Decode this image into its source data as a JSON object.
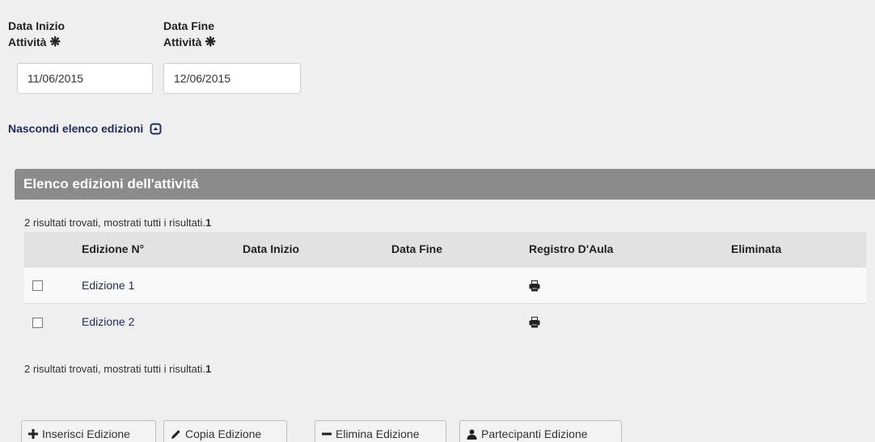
{
  "form": {
    "start_label_line1": "Data Inizio",
    "start_label_line2": "Attività",
    "end_label_line1": "Data Fine",
    "end_label_line2": "Attività",
    "required_mark": "❋",
    "start_value": "11/06/2015",
    "end_value": "12/06/2015"
  },
  "toggle": {
    "label": "Nascondi elenco edizioni"
  },
  "panel": {
    "title": "Elenco edizioni dell'attivitá"
  },
  "results": {
    "text": "2 risultati trovati, mostrati tutti i risultati.",
    "page": "1"
  },
  "table": {
    "headers": {
      "edition": "Edizione N°",
      "start": "Data Inizio",
      "end": "Data Fine",
      "register": "Registro D'Aula",
      "deleted": "Eliminata"
    },
    "rows": [
      {
        "edition": "Edizione 1",
        "start": "",
        "end": "",
        "deleted": ""
      },
      {
        "edition": "Edizione 2",
        "start": "",
        "end": "",
        "deleted": ""
      }
    ]
  },
  "buttons": {
    "insert": "Inserisci Edizione",
    "copy": "Copia Edizione",
    "delete": "Elimina Edizione",
    "participants": "Partecipanti Edizione"
  }
}
